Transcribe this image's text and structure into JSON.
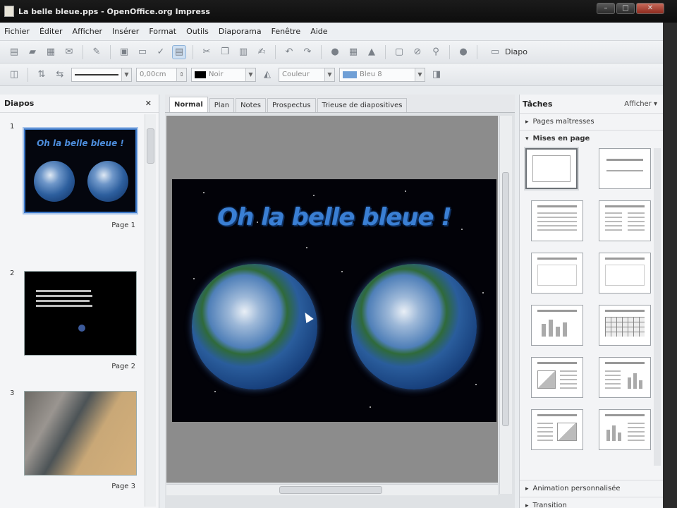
{
  "window": {
    "title": "La belle bleue.pps - OpenOffice.org Impress"
  },
  "menubar": [
    "Fichier",
    "Éditer",
    "Afficher",
    "Insérer",
    "Format",
    "Outils",
    "Diaporama",
    "Fenêtre",
    "Aide"
  ],
  "toolbar": {
    "diapo_label": "Diapo",
    "line_width": "0,00cm",
    "line_color": "Noir",
    "fill_type": "Couleur",
    "fill_color": "Bleu 8"
  },
  "slides_panel": {
    "title": "Diapos",
    "slides": [
      {
        "number": "1",
        "page_label": "Page 1",
        "title": "Oh la belle bleue !"
      },
      {
        "number": "2",
        "page_label": "Page 2"
      },
      {
        "number": "3",
        "page_label": "Page 3"
      }
    ]
  },
  "editor": {
    "tabs": [
      "Normal",
      "Plan",
      "Notes",
      "Prospectus",
      "Trieuse de diapositives"
    ],
    "active_tab": "Normal",
    "slide_title": "Oh la belle bleue !"
  },
  "tasks_panel": {
    "title": "Tâches",
    "view_button": "Afficher",
    "sections": {
      "master_pages": "Pages maîtresses",
      "layouts": "Mises en page",
      "custom_animation": "Animation personnalisée",
      "transition": "Transition"
    }
  },
  "colors": {
    "accent": "#3c78c8",
    "slide_title": "#3a7fd4",
    "slide_bg": "#020208"
  }
}
